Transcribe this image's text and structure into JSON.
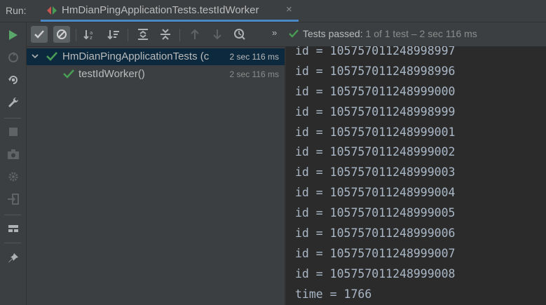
{
  "run_panel": {
    "label": "Run:",
    "tab_title": "HmDianPingApplicationTests.testIdWorker",
    "tab_close": "×"
  },
  "status": {
    "overflow": "»",
    "prefix": "Tests passed:",
    "count": "1",
    "suffix": "of 1 test – 2 sec 116 ms"
  },
  "tree": [
    {
      "label": "HmDianPingApplicationTests (c",
      "duration": "2 sec 116 ms",
      "expanded": true
    },
    {
      "label": "testIdWorker()",
      "duration": "2 sec 116 ms"
    }
  ],
  "console": [
    "id = 105757011248998997",
    "id = 105757011248998996",
    "id = 105757011248999000",
    "id = 105757011248998999",
    "id = 105757011248999001",
    "id = 105757011248999002",
    "id = 105757011248999003",
    "id = 105757011248999004",
    "id = 105757011248999005",
    "id = 105757011248999006",
    "id = 105757011248999007",
    "id = 105757011248999008",
    "time = 1766"
  ],
  "colors": {
    "pass_green": "#499c54",
    "run_green": "#59a869",
    "accent_blue": "#4a88c7",
    "selection": "#0d293e"
  }
}
